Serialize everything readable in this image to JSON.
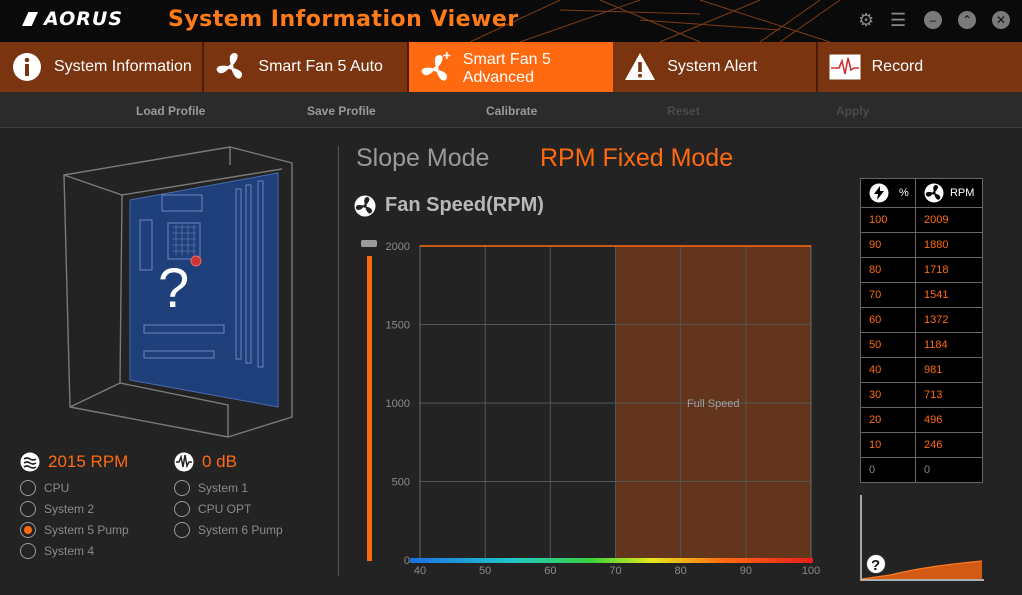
{
  "app": {
    "logo": "AORUS",
    "title": "System Information Viewer"
  },
  "window_controls": [
    {
      "name": "settings",
      "icon": "gear-icon",
      "glyph": "⚙"
    },
    {
      "name": "list",
      "icon": "list-icon",
      "glyph": "☰"
    },
    {
      "name": "minimize",
      "icon": "minimize-icon",
      "glyph": "–"
    },
    {
      "name": "maximize",
      "icon": "expand-icon",
      "glyph": "⌃"
    },
    {
      "name": "close",
      "icon": "close-icon",
      "glyph": "✕"
    }
  ],
  "tabs": [
    {
      "label": "System Information",
      "icon": "info-icon",
      "active": false
    },
    {
      "label": "Smart Fan 5 Auto",
      "icon": "fan-icon",
      "active": false
    },
    {
      "label": "Smart Fan 5 Advanced",
      "icon": "fan-plus-icon",
      "active": true
    },
    {
      "label": "System Alert",
      "icon": "warning-icon",
      "active": false
    },
    {
      "label": "Record",
      "icon": "pulse-icon",
      "active": false
    }
  ],
  "toolbar": {
    "load": "Load Profile",
    "save": "Save Profile",
    "calibrate": "Calibrate",
    "reset": "Reset",
    "apply": "Apply"
  },
  "case": {
    "unknown_glyph": "?"
  },
  "readings": {
    "rpm": "2015 RPM",
    "noise": "0 dB"
  },
  "fan_sources": {
    "left": [
      "CPU",
      "System 2",
      "System 5 Pump",
      "System 4"
    ],
    "right": [
      "System 1",
      "CPU OPT",
      "System 6 Pump"
    ],
    "selected": "System 5 Pump"
  },
  "modes": {
    "slope": "Slope Mode",
    "rpm_fixed": "RPM Fixed Mode",
    "active": "RPM Fixed Mode"
  },
  "fan_speed_title": "Fan Speed(RPM)",
  "slider": {
    "value": 2000
  },
  "chart_data": {
    "type": "area",
    "x_ticks": [
      40,
      50,
      60,
      70,
      80,
      90,
      100
    ],
    "y_ticks": [
      0,
      500,
      1000,
      1500,
      2000
    ],
    "xlim": [
      40,
      100
    ],
    "ylim": [
      0,
      2000
    ],
    "grid": true,
    "region": {
      "x_start": 70,
      "x_end": 100,
      "label": "Full Speed"
    },
    "colors": {
      "region": "#7a3c1c",
      "grid": "#555555",
      "accent": "#ff6a10"
    }
  },
  "table": {
    "header_percent": "%",
    "header_rpm": "RPM",
    "rows": [
      {
        "pct": "100",
        "rpm": "2009"
      },
      {
        "pct": "90",
        "rpm": "1880"
      },
      {
        "pct": "80",
        "rpm": "1718"
      },
      {
        "pct": "70",
        "rpm": "1541"
      },
      {
        "pct": "60",
        "rpm": "1372"
      },
      {
        "pct": "50",
        "rpm": "1184"
      },
      {
        "pct": "40",
        "rpm": "981"
      },
      {
        "pct": "30",
        "rpm": "713"
      },
      {
        "pct": "20",
        "rpm": "496"
      },
      {
        "pct": "10",
        "rpm": "246"
      },
      {
        "pct": "0",
        "rpm": "0"
      }
    ]
  },
  "mini_chart": {
    "help_glyph": "?"
  },
  "colors": {
    "accent": "#ff6a10",
    "tab_bg": "#7a3510",
    "background": "#232323"
  }
}
